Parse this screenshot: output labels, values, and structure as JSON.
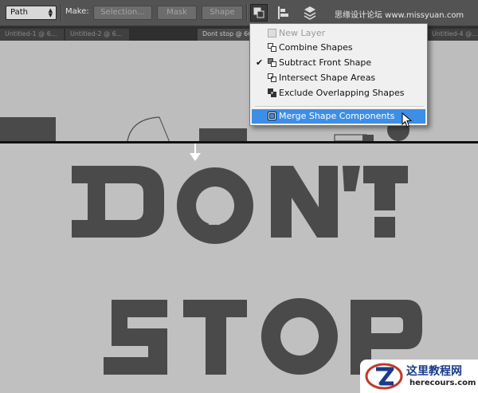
{
  "toolbar": {
    "path_select_value": "Path",
    "make_label": "Make:",
    "selection_button": "Selection...",
    "mask_button": "Mask",
    "shape_button": "Shape",
    "watermark": "思缘设计论坛 www.missyuan.com"
  },
  "tabs": [
    {
      "label": "Untitled-1 @ 6...",
      "active": false
    },
    {
      "label": "Untitled-2 @ 6...",
      "active": false
    },
    {
      "label": "Dont stop @ 66.7%",
      "active": true
    },
    {
      "label": "Untitled-4 @...",
      "active": false
    }
  ],
  "path_operations_menu": {
    "items": [
      {
        "label": "New Layer",
        "disabled": true,
        "checked": false,
        "icon": "new-layer-icon"
      },
      {
        "label": "Combine Shapes",
        "disabled": false,
        "checked": false,
        "icon": "combine-shapes-icon"
      },
      {
        "label": "Subtract Front Shape",
        "disabled": false,
        "checked": true,
        "icon": "subtract-front-shape-icon"
      },
      {
        "label": "Intersect Shape Areas",
        "disabled": false,
        "checked": false,
        "icon": "intersect-shape-areas-icon"
      },
      {
        "label": "Exclude Overlapping Shapes",
        "disabled": false,
        "checked": false,
        "icon": "exclude-overlapping-shapes-icon"
      }
    ],
    "highlighted_item": {
      "label": "Merge Shape Components",
      "icon": "merge-shape-components-icon"
    }
  },
  "artwork": {
    "line1": "DON'T",
    "line2": "STOP",
    "text_color": "#4a4a4a"
  },
  "logo": {
    "title": "这里教程网",
    "url": "herecours.com",
    "accent": "#1a3a8a"
  },
  "colors": {
    "toolbar_bg": "#535353",
    "menu_highlight": "#3d8ee6",
    "canvas_bg": "#c0c0c0"
  }
}
